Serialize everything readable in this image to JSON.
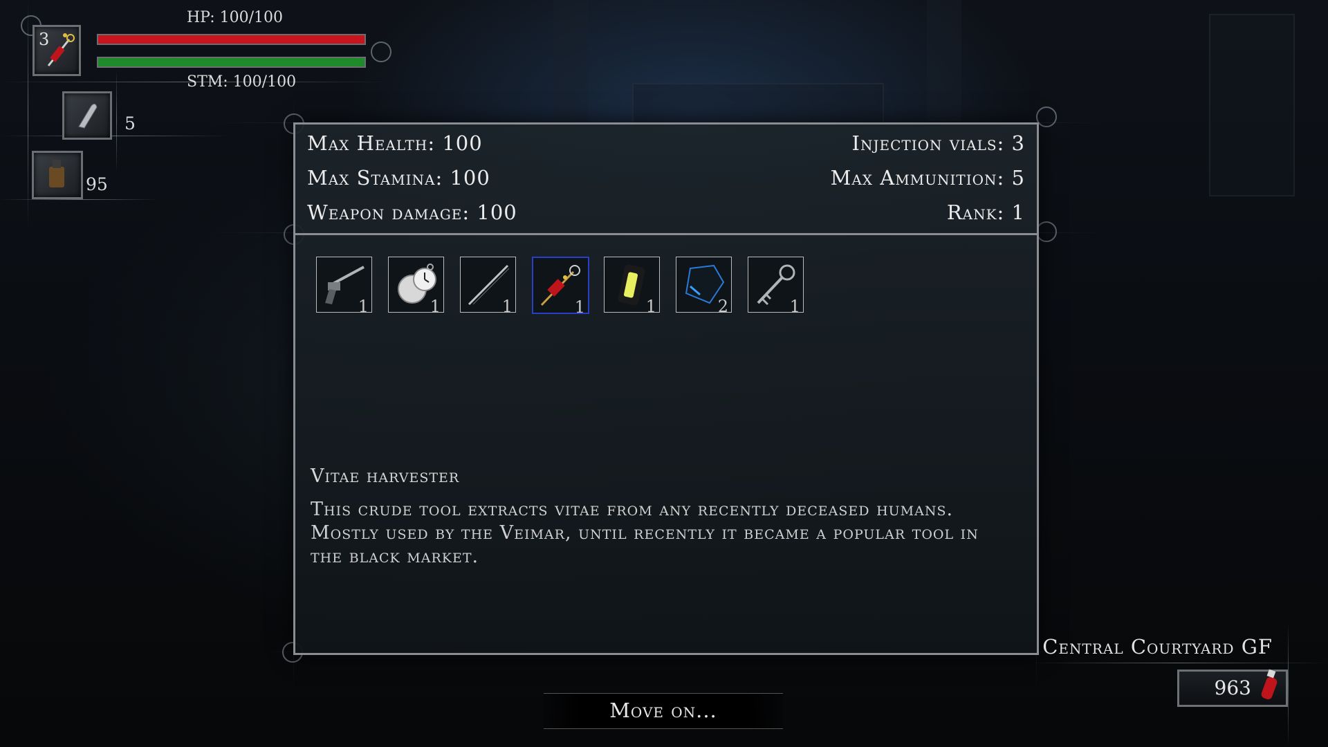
{
  "hud": {
    "vial_count": "3",
    "hp_label": "HP: 100/100",
    "stm_label": "STM: 100/100",
    "hp_fraction": 1.0,
    "stm_fraction": 1.0,
    "ammo_count": "5",
    "consumable_count": "95",
    "colors": {
      "hp": "#c8141c",
      "stamina": "#1f8a2a"
    }
  },
  "stats": {
    "max_health": "Max Health: 100",
    "max_stamina": "Max Stamina: 100",
    "weapon_damage": "Weapon damage: 100",
    "injection_vials": "Injection vials: 3",
    "max_ammunition": "Max Ammunition: 5",
    "rank": "Rank: 1"
  },
  "inventory": [
    {
      "icon": "revolver-icon",
      "qty": "1"
    },
    {
      "icon": "pocket-watch-icon",
      "qty": "1"
    },
    {
      "icon": "cane-icon",
      "qty": "1"
    },
    {
      "icon": "vitae-harvester-icon",
      "qty": "1",
      "selected": true
    },
    {
      "icon": "lantern-icon",
      "qty": "1"
    },
    {
      "icon": "blue-gem-icon",
      "qty": "2"
    },
    {
      "icon": "ornate-key-icon",
      "qty": "1"
    }
  ],
  "selected_item": {
    "title": "Vitae harvester",
    "description": "This crude tool extracts vitae from any recently deceased humans. Mostly used by the Veimar, until recently it became a popular tool in the black market."
  },
  "move_on_label": "Move on...",
  "location": "Central Courtyard GF",
  "currency": "963",
  "selection_color": "#2840c8"
}
